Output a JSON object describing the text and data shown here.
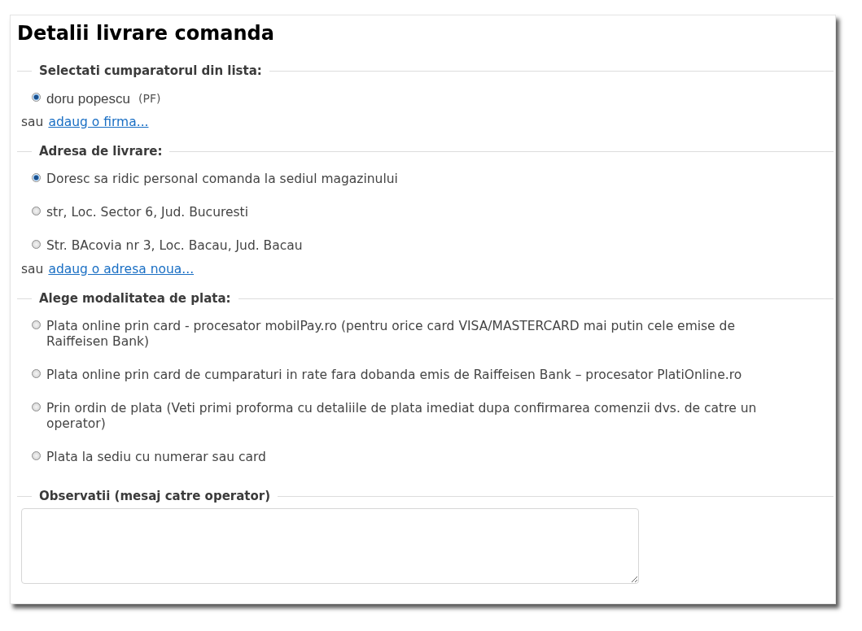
{
  "title": "Detalii livrare comanda",
  "sections": [
    {
      "legend": "Selectati cumparatorul din lista:",
      "options": [
        {
          "label": "doru popescu",
          "tag": "(PF)",
          "selected": true
        }
      ],
      "add_prefix": "sau",
      "add_link": "adaug o firma..."
    },
    {
      "legend": "Adresa de livrare:",
      "options": [
        {
          "label": "Doresc sa ridic personal comanda la sediul magazinului",
          "selected": true
        },
        {
          "label": "str, Loc. Sector 6, Jud. Bucuresti",
          "selected": false
        },
        {
          "label": "Str. BAcovia nr 3, Loc. Bacau, Jud. Bacau",
          "selected": false
        }
      ],
      "add_prefix": "sau",
      "add_link": "adaug o adresa noua..."
    },
    {
      "legend": "Alege modalitatea de plata:",
      "options": [
        {
          "label": "Plata online prin card - procesator mobilPay.ro (pentru orice card VISA/MASTERCARD mai putin cele emise de Raiffeisen Bank)",
          "selected": false
        },
        {
          "label": "Plata online prin card de cumparaturi in rate fara dobanda emis de Raiffeisen Bank – procesator PlatiOnline.ro",
          "selected": false
        },
        {
          "label": "Prin ordin de plata (Veti primi proforma cu detaliile de plata imediat dupa confirmarea comenzii dvs. de catre un operator)",
          "selected": false
        },
        {
          "label": "Plata la sediu cu numerar sau card",
          "selected": false
        }
      ]
    }
  ],
  "notes": {
    "legend": "Observatii (mesaj catre operator)"
  }
}
